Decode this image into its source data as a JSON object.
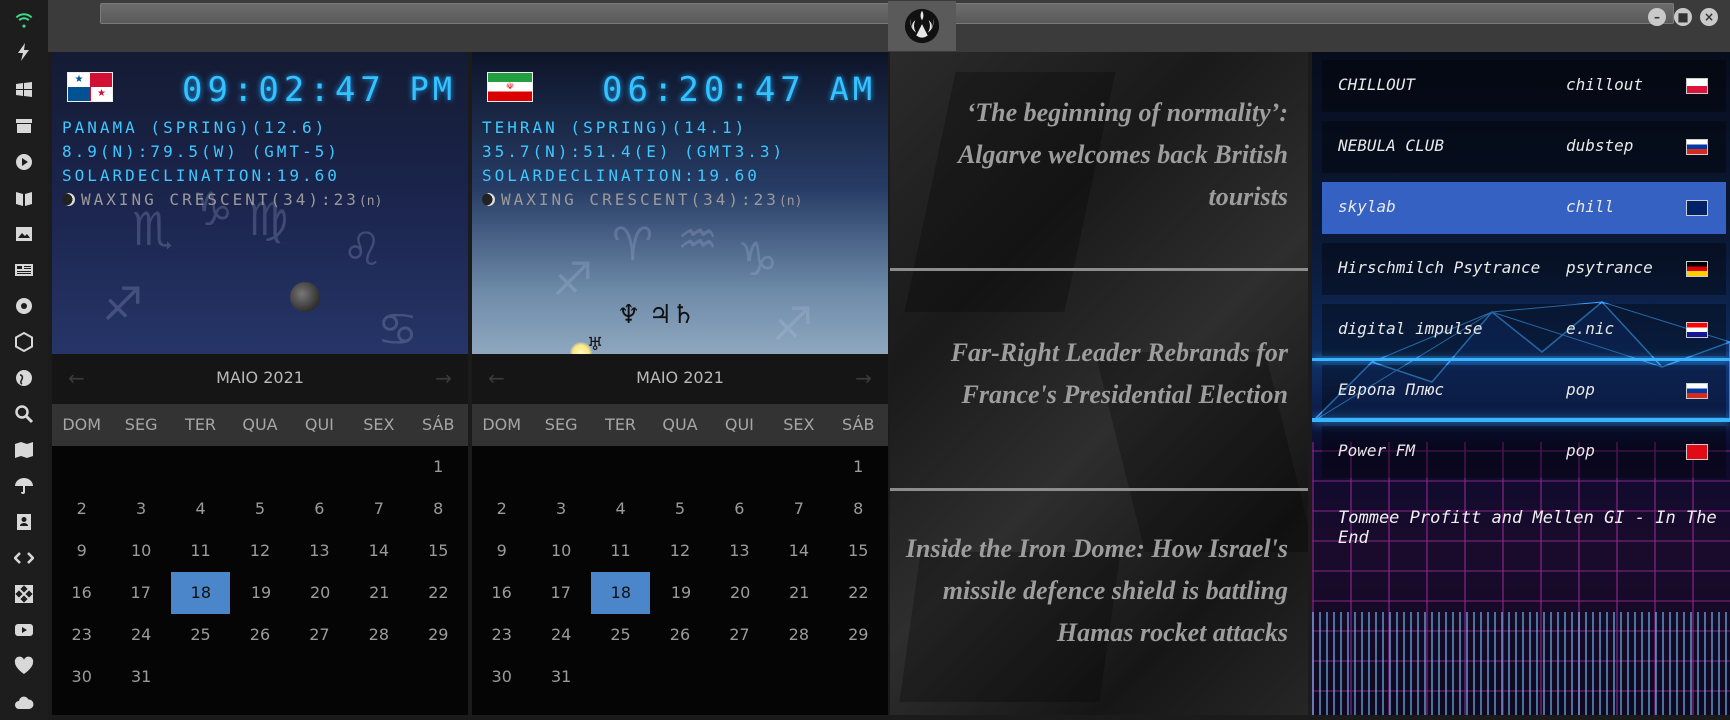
{
  "sidebar": {
    "icons": [
      "wifi-icon",
      "bolt-icon",
      "windows-icon",
      "archive-icon",
      "play-icon",
      "book-icon",
      "image-icon",
      "newspaper-icon",
      "aperture-icon",
      "hexagon-icon",
      "globe-icon",
      "search-icon",
      "map-icon",
      "umbrella-icon",
      "contact-icon",
      "code-icon",
      "expand-icon",
      "youtube-icon",
      "heart-icon",
      "cloud-icon"
    ]
  },
  "topbar": {
    "url": "",
    "logo": "rebel-alliance-icon"
  },
  "clocks": [
    {
      "flag": "panama-flag",
      "time": "09:02:47",
      "ampm": "PM",
      "line1": "PANAMA (SPRING)(12.6)",
      "line2": "8.9(N):79.5(W) (GMT-5)",
      "line3": "SOLARDECLINATION:19.60",
      "moon": "WAXING CRESCENT(34):23",
      "moon_suffix": "(n)"
    },
    {
      "flag": "iran-flag",
      "time": "06:20:47",
      "ampm": "AM",
      "line1": "TEHRAN (SPRING)(14.1)",
      "line2": "35.7(N):51.4(E) (GMT3.3)",
      "line3": "SOLARDECLINATION:19.60",
      "moon": "WAXING CRESCENT(34):23",
      "moon_suffix": "(n)",
      "planets": "♆ ♃♄",
      "planet_extra": "♅"
    }
  ],
  "calendars": [
    {
      "month": "MAIO 2021",
      "prev": "←",
      "next": "→",
      "weekdays": [
        "DOM",
        "SEG",
        "TER",
        "QUA",
        "QUI",
        "SEX",
        "SÁB"
      ],
      "rows": [
        [
          "",
          "",
          "",
          "",
          "",
          "",
          "1"
        ],
        [
          "2",
          "3",
          "4",
          "5",
          "6",
          "7",
          "8"
        ],
        [
          "9",
          "10",
          "11",
          "12",
          "13",
          "14",
          "15"
        ],
        [
          "16",
          "17",
          "18",
          "19",
          "20",
          "21",
          "22"
        ],
        [
          "23",
          "24",
          "25",
          "26",
          "27",
          "28",
          "29"
        ],
        [
          "30",
          "31",
          "",
          "",
          "",
          "",
          ""
        ]
      ],
      "today": "18"
    },
    {
      "month": "MAIO 2021",
      "prev": "←",
      "next": "→",
      "weekdays": [
        "DOM",
        "SEG",
        "TER",
        "QUA",
        "QUI",
        "SEX",
        "SÁB"
      ],
      "rows": [
        [
          "",
          "",
          "",
          "",
          "",
          "",
          "1"
        ],
        [
          "2",
          "3",
          "4",
          "5",
          "6",
          "7",
          "8"
        ],
        [
          "9",
          "10",
          "11",
          "12",
          "13",
          "14",
          "15"
        ],
        [
          "16",
          "17",
          "18",
          "19",
          "20",
          "21",
          "22"
        ],
        [
          "23",
          "24",
          "25",
          "26",
          "27",
          "28",
          "29"
        ],
        [
          "30",
          "31",
          "",
          "",
          "",
          "",
          ""
        ]
      ],
      "today": "18"
    }
  ],
  "news": [
    "‘The beginning of normality’: Algarve welcomes back British tourists",
    "Far-Right Leader Rebrands for France's Presidential Election",
    "Inside the Iron Dome: How Israel's missile defence shield is battling Hamas rocket attacks"
  ],
  "radio": {
    "stations": [
      {
        "name": "CHILLOUT",
        "genre": "chillout",
        "flag": "poland-flag"
      },
      {
        "name": "NEBULA CLUB",
        "genre": "dubstep",
        "flag": "russia-flag"
      },
      {
        "name": "skylab",
        "genre": "chill",
        "flag": "uk-flag"
      },
      {
        "name": "Hirschmilch Psytrance",
        "genre": "psytrance",
        "flag": "germany-flag"
      },
      {
        "name": "digital impulse",
        "genre": "e.nic",
        "flag": "croatia-flag"
      },
      {
        "name": "Европа Плюс",
        "genre": "pop",
        "flag": "russia-flag"
      },
      {
        "name": "Power FM",
        "genre": "pop",
        "flag": "turkey-flag"
      }
    ],
    "active_index": 2,
    "now_playing": "Tommee Profitt and Mellen GI - In The End"
  }
}
